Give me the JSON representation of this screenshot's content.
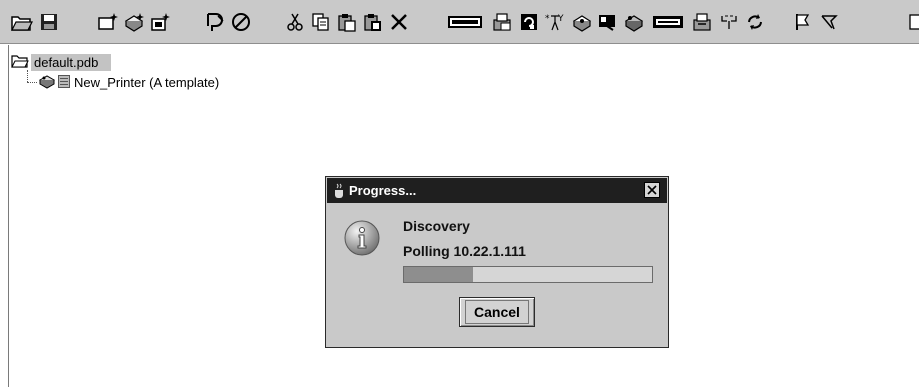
{
  "toolbar": {
    "buttons": [
      {
        "icon": "open-folder-icon"
      },
      {
        "icon": "save-icon"
      },
      {
        "icon": "new-item-icon"
      },
      {
        "icon": "new-printer-icon"
      },
      {
        "icon": "new-document-icon"
      },
      {
        "icon": "edit-icon"
      },
      {
        "icon": "stop-icon"
      },
      {
        "icon": "cut-icon"
      },
      {
        "icon": "copy-icon"
      },
      {
        "icon": "paste-icon"
      },
      {
        "icon": "paste-special-icon"
      },
      {
        "icon": "delete-icon"
      },
      {
        "icon": "keyboard-icon"
      },
      {
        "icon": "printer-settings-icon"
      },
      {
        "icon": "refresh-document-icon"
      },
      {
        "icon": "network-icon"
      },
      {
        "icon": "printer-config-icon"
      },
      {
        "icon": "inspect-icon"
      },
      {
        "icon": "printer-driver-icon"
      },
      {
        "icon": "card-icon"
      },
      {
        "icon": "print-queue-icon"
      },
      {
        "icon": "split-icon"
      },
      {
        "icon": "sync-icon"
      },
      {
        "icon": "flag-icon"
      },
      {
        "icon": "tools-icon"
      }
    ]
  },
  "tree": {
    "root_label": "default.pdb",
    "children": [
      {
        "label": "New_Printer (A template)"
      }
    ]
  },
  "dialog": {
    "title": "Progress...",
    "message_title": "Discovery",
    "message_detail": "Polling 10.22.1.111",
    "progress": 0.28,
    "cancel_label": "Cancel"
  }
}
